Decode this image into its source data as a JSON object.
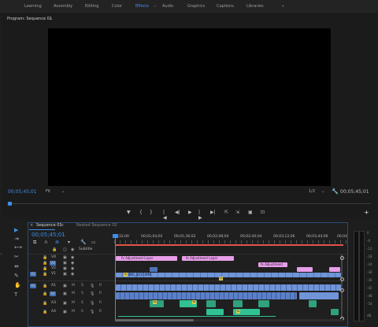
{
  "workspaces": {
    "items": [
      "Learning",
      "Assembly",
      "Editing",
      "Color",
      "Effects",
      "Audio",
      "Graphics",
      "Captions",
      "Libraries"
    ],
    "active": "Effects",
    "overflow": "»"
  },
  "program_monitor": {
    "title": "Program: Sequence 01",
    "menu_glyph": "≡",
    "timecode_in": "00;05;45;01",
    "fit_label": "Fit",
    "resolution_label": "1/2",
    "timecode_duration": "00;05;45;01"
  },
  "transport": {
    "marker": "▼",
    "in": "{",
    "out": "}",
    "go_in": "|◀",
    "step_back": "◀|",
    "play": "▶",
    "step_fwd": "|▶",
    "go_out": "▶|",
    "lift": "⇱",
    "extract": "⇲",
    "export_frame": "▣",
    "comparison": "⊡",
    "add": "+"
  },
  "tools": {
    "selection": "▶",
    "track_select": "⇥",
    "ripple": "⟷",
    "razor": "✂",
    "slip": "⇹",
    "pen": "✎",
    "hand": "✋",
    "type": "T",
    "more": "»"
  },
  "timeline": {
    "tabs": [
      {
        "label": "Sequence 01",
        "menu": "≡",
        "active": true
      },
      {
        "label": "Nested Sequence 02",
        "active": false
      }
    ],
    "close_glyph": "×",
    "timecode": "00;05;45;01",
    "ruler_labels": [
      ":0;32;00",
      "00;01;04;02",
      "00;01;36;02",
      "00;02;08;04",
      "00;02;40;04",
      "00;03;12;06",
      "00;03;44;06",
      "00;04"
    ],
    "subtitle_track": "Subtitle",
    "video_tracks": [
      {
        "name": "V4"
      },
      {
        "name": "V3"
      },
      {
        "name": "V2"
      },
      {
        "name": "V1",
        "source": "V1"
      }
    ],
    "audio_tracks": [
      {
        "name": "A1",
        "source": "A1",
        "m": "M",
        "s": "S",
        "r": "R"
      },
      {
        "name": "A2",
        "m": "M",
        "s": "S",
        "r": "R"
      },
      {
        "name": "A3",
        "m": "M",
        "s": "S",
        "r": "R"
      },
      {
        "name": "A4",
        "m": "M",
        "s": "S",
        "r": "R"
      }
    ],
    "clips": {
      "adjustment_1": "Adjustment Layer",
      "adjustment_2": "Adjustment Layer",
      "adjustment_3": "Adjustment",
      "video_clip": "IMG_3017.MP4"
    },
    "fx_badge": "fx"
  },
  "meters": {
    "labels": [
      "0",
      "-6",
      "-12",
      "-18",
      "-24",
      "-30",
      "-36",
      "-42",
      "-48",
      "-54",
      "dB"
    ]
  },
  "colors": {
    "accent": "#3e8de8",
    "adjustment_clip": "#e79ee8",
    "video_clip": "#6f94d8",
    "audio_clip": "#2fa17e",
    "work_area": "#e0534a"
  }
}
